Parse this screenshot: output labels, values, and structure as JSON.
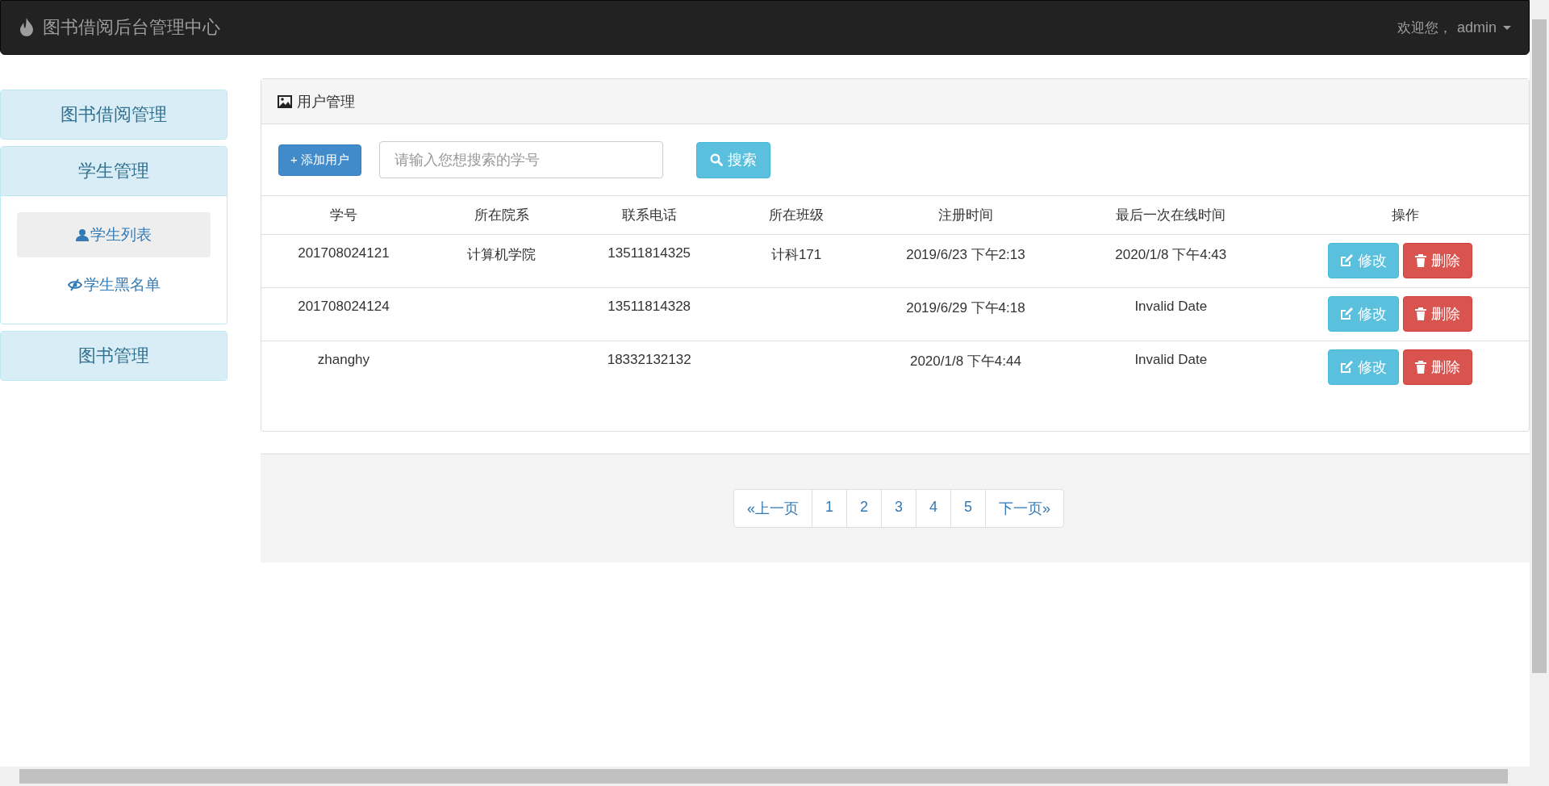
{
  "navbar": {
    "brand": "图书借阅后台管理中心",
    "welcome": "欢迎您，",
    "user": "admin"
  },
  "sidebar": [
    {
      "label": "图书借阅管理",
      "expanded": false
    },
    {
      "label": "学生管理",
      "expanded": true,
      "children": [
        {
          "label": "学生列表",
          "kind": "user",
          "selected": true
        },
        {
          "label": "学生黑名单",
          "kind": "blacklist",
          "selected": false
        }
      ]
    },
    {
      "label": "图书管理",
      "expanded": false
    }
  ],
  "panel": {
    "title": "用户管理",
    "add_button": "+ 添加用户",
    "search": {
      "placeholder": "请输入您想搜索的学号"
    },
    "search_button": "搜索"
  },
  "table": {
    "columns": [
      "学号",
      "所在院系",
      "联系电话",
      "所在班级",
      "注册时间",
      "最后一次在线时间",
      "操作"
    ],
    "rows": [
      {
        "cells": [
          "201708024121",
          "计算机学院",
          "13511814325",
          "计科171",
          "2019/6/23 下午2:13",
          "2020/1/8 下午4:43"
        ],
        "edit": "修改",
        "delete": "删除"
      },
      {
        "cells": [
          "201708024124",
          "",
          "13511814328",
          "",
          "2019/6/29 下午4:18",
          "Invalid Date"
        ],
        "edit": "修改",
        "delete": "删除"
      },
      {
        "cells": [
          "zhanghy",
          "",
          "18332132132",
          "",
          "2020/1/8 下午4:44",
          "Invalid Date"
        ],
        "edit": "修改",
        "delete": "删除"
      }
    ]
  },
  "pagination": [
    "«上一页",
    "1",
    "2",
    "3",
    "4",
    "5",
    "下一页»"
  ]
}
